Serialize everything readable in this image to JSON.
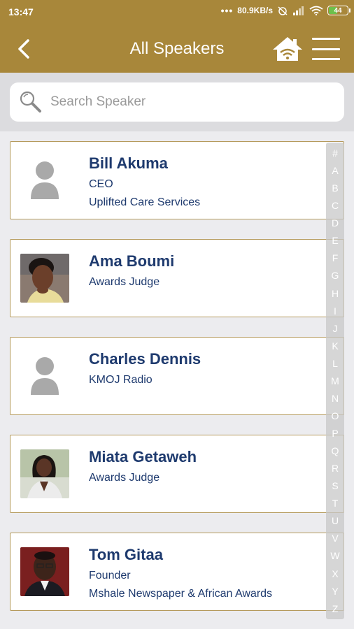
{
  "status_bar": {
    "time": "13:47",
    "network_speed": "80.9KB/s",
    "battery_level": "44",
    "battery_fraction": 0.44,
    "colors": {
      "background": "#a8873a",
      "battery_fill": "#6cc04a"
    }
  },
  "header": {
    "title": "All Speakers",
    "back_icon": "chevron-left-icon",
    "home_icon": "home-wifi-icon",
    "menu_icon": "hamburger-menu-icon",
    "accent_color": "#a8873a"
  },
  "search": {
    "placeholder": "Search Speaker",
    "value": "",
    "icon": "search-icon"
  },
  "speakers": [
    {
      "name": "Bill Akuma",
      "line1": "CEO",
      "line2": "Uplifted Care Services",
      "avatar": "person-placeholder-icon"
    },
    {
      "name": "Ama Boumi",
      "line1": "Awards Judge",
      "line2": "",
      "avatar": "speaker-photo"
    },
    {
      "name": "Charles Dennis",
      "line1": "KMOJ Radio",
      "line2": "",
      "avatar": "person-placeholder-icon"
    },
    {
      "name": "Miata Getaweh",
      "line1": "Awards Judge",
      "line2": "",
      "avatar": "speaker-photo"
    },
    {
      "name": "Tom Gitaa",
      "line1": "Founder",
      "line2": "Mshale Newspaper & African Awards",
      "avatar": "speaker-photo"
    }
  ],
  "alphabet_index": [
    "#",
    "A",
    "B",
    "C",
    "D",
    "E",
    "F",
    "G",
    "H",
    "I",
    "J",
    "K",
    "L",
    "M",
    "N",
    "O",
    "P",
    "Q",
    "R",
    "S",
    "T",
    "U",
    "V",
    "W",
    "X",
    "Y",
    "Z"
  ],
  "text_color": "#1e3a6e"
}
